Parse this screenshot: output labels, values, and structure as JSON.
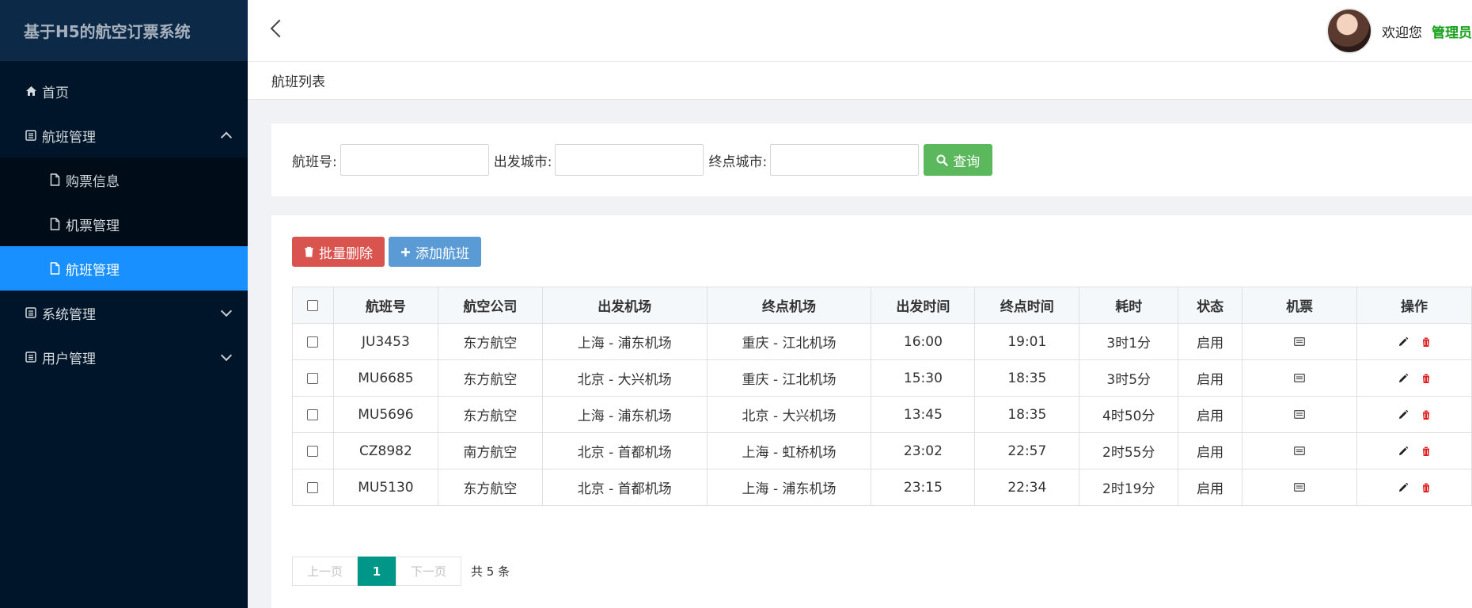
{
  "app": {
    "title": "基于H5的航空订票系统"
  },
  "sidebar": {
    "items": [
      {
        "label": "首页"
      },
      {
        "label": "航班管理"
      },
      {
        "label": "购票信息"
      },
      {
        "label": "机票管理"
      },
      {
        "label": "航班管理"
      },
      {
        "label": "系统管理"
      },
      {
        "label": "用户管理"
      }
    ]
  },
  "header": {
    "welcome": "欢迎您",
    "username": "管理员"
  },
  "breadcrumb": {
    "current": "航班列表"
  },
  "search": {
    "flight_no_label": "航班号:",
    "from_city_label": "出发城市:",
    "to_city_label": "终点城市:",
    "flight_no_value": "",
    "from_city_value": "",
    "to_city_value": "",
    "button_label": "查询"
  },
  "toolbar": {
    "batch_delete_label": "批量删除",
    "add_label": "添加航班"
  },
  "table": {
    "headers": [
      "航班号",
      "航空公司",
      "出发机场",
      "终点机场",
      "出发时间",
      "终点时间",
      "耗时",
      "状态",
      "机票",
      "操作"
    ],
    "rows": [
      [
        "JU3453",
        "东方航空",
        "上海 - 浦东机场",
        "重庆 - 江北机场",
        "16:00",
        "19:01",
        "3时1分",
        "启用"
      ],
      [
        "MU6685",
        "东方航空",
        "北京 - 大兴机场",
        "重庆 - 江北机场",
        "15:30",
        "18:35",
        "3时5分",
        "启用"
      ],
      [
        "MU5696",
        "东方航空",
        "上海 - 浦东机场",
        "北京 - 大兴机场",
        "13:45",
        "18:35",
        "4时50分",
        "启用"
      ],
      [
        "CZ8982",
        "南方航空",
        "北京 - 首都机场",
        "上海 - 虹桥机场",
        "23:02",
        "22:57",
        "2时55分",
        "启用"
      ],
      [
        "MU5130",
        "东方航空",
        "北京 - 首都机场",
        "上海 - 浦东机场",
        "23:15",
        "22:34",
        "2时19分",
        "启用"
      ]
    ]
  },
  "pager": {
    "prev": "上一页",
    "current": "1",
    "next": "下一页",
    "total": "共 5 条"
  },
  "colors": {
    "sidebar_bg": "#001529",
    "active": "#1890ff",
    "search_btn": "#5cb85c",
    "danger": "#d9534f",
    "primary": "#5b9bd5",
    "pager_active": "#009688",
    "delete_icon": "#e02020"
  }
}
